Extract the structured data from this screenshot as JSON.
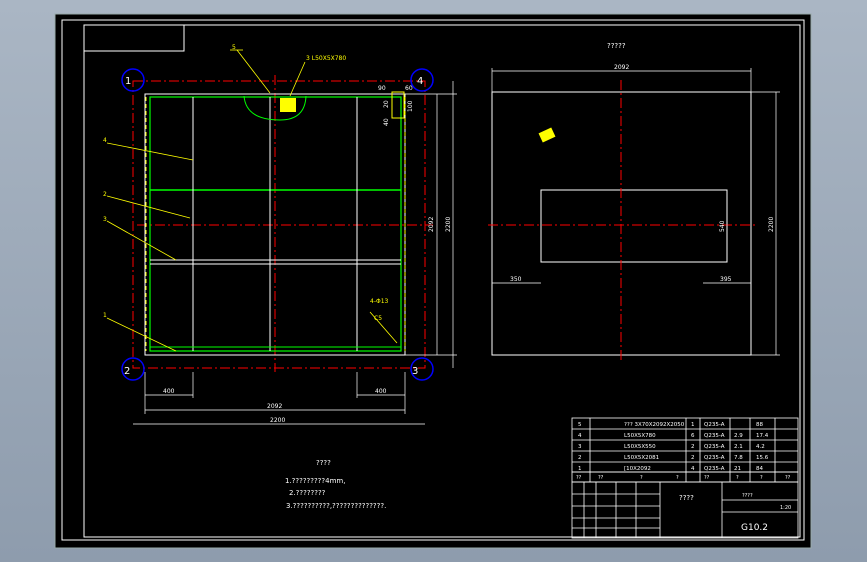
{
  "colors": {
    "background": "#000000",
    "border": "#ffffff",
    "outline": "#ffffff",
    "frame": "#ffffff",
    "centerline": "#ff0000",
    "hidden": "#ffff00",
    "dimension": "#ffffff",
    "part": "#00ff00",
    "callout": "#ffff00",
    "title": "#ffff00"
  },
  "top_view": {
    "corner_numbers": [
      "1",
      "2",
      "3",
      "4"
    ],
    "balloons": [
      "5",
      "4",
      "2",
      "3",
      "1"
    ],
    "dims": {
      "left_offset": "400",
      "right_offset": "400",
      "inner_width": "2092",
      "total_width": "2200",
      "inner_height": "2092",
      "total_height": "2200",
      "small_90": "90",
      "small_60": "60",
      "d20": "20",
      "d40": "40",
      "d100": "100"
    },
    "notes": {
      "weld_top": "3 L50X5X780",
      "weld_corner": "4-Φ13",
      "corner_sym": "C5"
    }
  },
  "side_view": {
    "title": "?????",
    "dims": {
      "width": "2092",
      "height": "2200",
      "slot_h": "540",
      "left": "350",
      "right": "395"
    }
  },
  "tech_notes": {
    "title": "????",
    "lines": [
      "1.?????????4mm,",
      "2.????????",
      "3.??????????,??????????????."
    ]
  },
  "bom": {
    "rows": [
      {
        "no": "5",
        "name": "??? 3X70X2092X2050",
        "qty": "1",
        "material": "Q235-A",
        "unit": "",
        "total": "88"
      },
      {
        "no": "4",
        "name": "L50X5X780",
        "qty": "6",
        "material": "Q235-A",
        "unit": "2.9",
        "total": "17.4"
      },
      {
        "no": "3",
        "name": "L50X5X550",
        "qty": "2",
        "material": "Q235-A",
        "unit": "2.1",
        "total": "4.2"
      },
      {
        "no": "2",
        "name": "L50X5X2081",
        "qty": "2",
        "material": "Q235-A",
        "unit": "7.8",
        "total": "15.6"
      },
      {
        "no": "1",
        "name": "[10X2092",
        "qty": "4",
        "material": "Q235-A",
        "unit": "21",
        "total": "84"
      }
    ],
    "header_row": [
      "??",
      "??",
      "?",
      "?",
      "??",
      "?",
      "?",
      "??"
    ],
    "extra": "????"
  },
  "title_block": {
    "drawing_name": "????",
    "drawing_no": "G10.2",
    "scale_label": "1:20",
    "sheet_label": "????"
  }
}
